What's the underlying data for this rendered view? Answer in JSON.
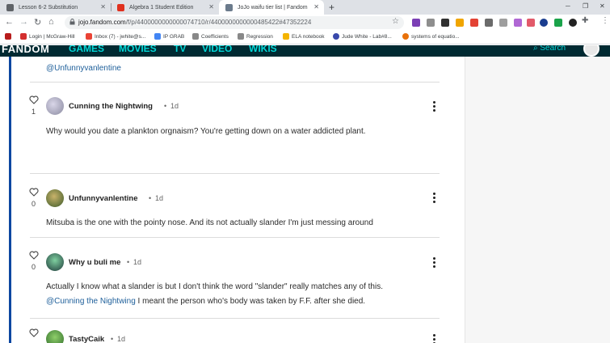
{
  "browser": {
    "tabs": [
      {
        "title": "Lesson 6-2 Substitution",
        "active": false
      },
      {
        "title": "Algebra 1 Student Edition",
        "active": false
      },
      {
        "title": "JoJo waifu tier list | Fandom",
        "active": true
      }
    ],
    "url_host": "jojo.fandom.com",
    "url_path": "/f/p/4400000000000074710/r/4400000000000485422#47352224"
  },
  "bookmarks": [
    "Login | McGraw-Hill",
    "Inbox (7) - jwhite@s...",
    "IP GRAB",
    "Coefficients",
    "Regression",
    "ELA notebook",
    "Jude White - Lab#8...",
    "systems of equatio..."
  ],
  "fandom": {
    "logo": "FANDOM",
    "nav": [
      "GAMES",
      "MOVIES",
      "TV",
      "VIDEO",
      "WIKIS"
    ],
    "search": "Search"
  },
  "thread": {
    "top_mention": "@Unfunnyvanlentine",
    "replies": [
      {
        "username": "Cunning the Nightwing",
        "time": "1d",
        "likes": "1",
        "lines": [
          "Why would you date a plankton orgnaism? You're getting down on a water addicted plant."
        ]
      },
      {
        "username": "Unfunnyvanlentine",
        "time": "1d",
        "likes": "0",
        "lines": [
          "Mitsuba is the one with the pointy nose. And its not actually slander I'm just messing around"
        ]
      },
      {
        "username": "Why u buli me",
        "time": "1d",
        "likes": "0",
        "lines": [
          "Actually I know what a slander is but I don't think the word \"slander\" really matches any of this."
        ],
        "mention": "@Cunning the Nightwing",
        "after_mention": " I meant the person who's body was taken by F.F. after she died."
      },
      {
        "username": "TastyCaik",
        "time": "1d",
        "likes": "",
        "lines": []
      }
    ]
  }
}
